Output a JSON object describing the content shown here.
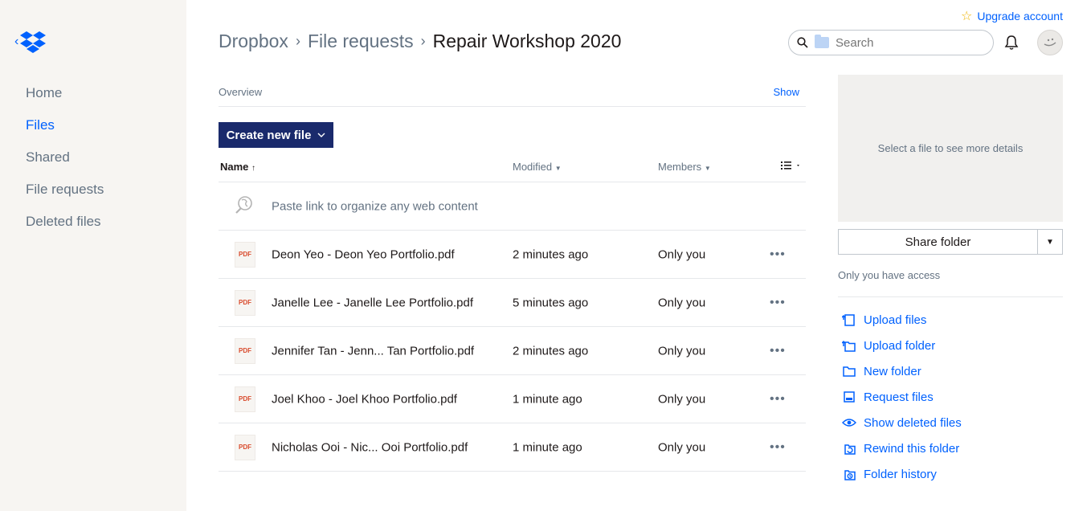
{
  "upgrade": {
    "label": "Upgrade account"
  },
  "sidebar": {
    "items": [
      {
        "label": "Home",
        "active": false
      },
      {
        "label": "Files",
        "active": true
      },
      {
        "label": "Shared",
        "active": false
      },
      {
        "label": "File requests",
        "active": false
      },
      {
        "label": "Deleted files",
        "active": false
      }
    ]
  },
  "breadcrumb": [
    "Dropbox",
    "File requests",
    "Repair Workshop 2020"
  ],
  "search": {
    "placeholder": "Search"
  },
  "overview": {
    "label": "Overview",
    "show": "Show"
  },
  "create_button": {
    "label": "Create new file"
  },
  "table": {
    "headers": {
      "name": "Name",
      "modified": "Modified",
      "members": "Members"
    },
    "paste_text": "Paste link to organize any web content",
    "file_icon_text": "PDF",
    "rows": [
      {
        "name": "Deon Yeo - Deon Yeo Portfolio.pdf",
        "modified": "2 minutes ago",
        "members": "Only you"
      },
      {
        "name": "Janelle Lee - Janelle Lee Portfolio.pdf",
        "modified": "5 minutes ago",
        "members": "Only you"
      },
      {
        "name": "Jennifer Tan - Jenn... Tan Portfolio.pdf",
        "modified": "2 minutes ago",
        "members": "Only you"
      },
      {
        "name": "Joel Khoo - Joel Khoo Portfolio.pdf",
        "modified": "1 minute ago",
        "members": "Only you"
      },
      {
        "name": "Nicholas Ooi - Nic... Ooi Portfolio.pdf",
        "modified": "1 minute ago",
        "members": "Only you"
      }
    ]
  },
  "details": {
    "placeholder": "Select a file to see more details",
    "share_label": "Share folder",
    "access": "Only you have access",
    "actions": [
      {
        "label": "Upload files",
        "icon": "upload-file-icon"
      },
      {
        "label": "Upload folder",
        "icon": "upload-folder-icon"
      },
      {
        "label": "New folder",
        "icon": "folder-icon"
      },
      {
        "label": "Request files",
        "icon": "request-files-icon"
      },
      {
        "label": "Show deleted files",
        "icon": "eye-icon"
      },
      {
        "label": "Rewind this folder",
        "icon": "rewind-icon"
      },
      {
        "label": "Folder history",
        "icon": "history-icon"
      }
    ]
  },
  "colors": {
    "accent": "#0061fe",
    "primary_button": "#1a2a6c",
    "sidebar_bg": "#f7f5f2",
    "pdf": "#d94a2c"
  }
}
